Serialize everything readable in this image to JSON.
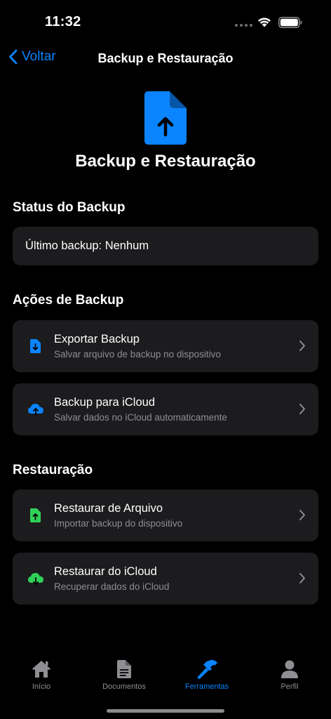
{
  "status_bar": {
    "time": "11:32"
  },
  "nav": {
    "back_label": "Voltar",
    "title": "Backup e Restauração"
  },
  "header": {
    "title": "Backup e Restauração",
    "icon": "doc-arrow-up-icon"
  },
  "status_section": {
    "title": "Status do Backup",
    "last_backup": "Último backup: Nenhum"
  },
  "backup_section": {
    "title": "Ações de Backup",
    "items": [
      {
        "title": "Exportar Backup",
        "subtitle": "Salvar arquivo de backup no dispositivo",
        "icon": "doc-download-icon",
        "color": "#0a84ff"
      },
      {
        "title": "Backup para iCloud",
        "subtitle": "Salvar dados no iCloud automaticamente",
        "icon": "icloud-upload-icon",
        "color": "#0a84ff"
      }
    ]
  },
  "restore_section": {
    "title": "Restauração",
    "items": [
      {
        "title": "Restaurar de Arquivo",
        "subtitle": "Importar backup do dispositivo",
        "icon": "doc-upload-icon",
        "color": "#30d158"
      },
      {
        "title": "Restaurar do iCloud",
        "subtitle": "Recuperar dados do iCloud",
        "icon": "icloud-download-icon",
        "color": "#30d158"
      }
    ]
  },
  "tabs": [
    {
      "label": "Início",
      "icon": "house-icon",
      "active": false
    },
    {
      "label": "Documentos",
      "icon": "document-icon",
      "active": false
    },
    {
      "label": "Ferramentas",
      "icon": "hammer-icon",
      "active": true
    },
    {
      "label": "Perfil",
      "icon": "person-icon",
      "active": false
    }
  ],
  "colors": {
    "accent": "#0a84ff",
    "green": "#30d158",
    "card": "#1c1c1e",
    "secondary_text": "#8e8e93"
  }
}
